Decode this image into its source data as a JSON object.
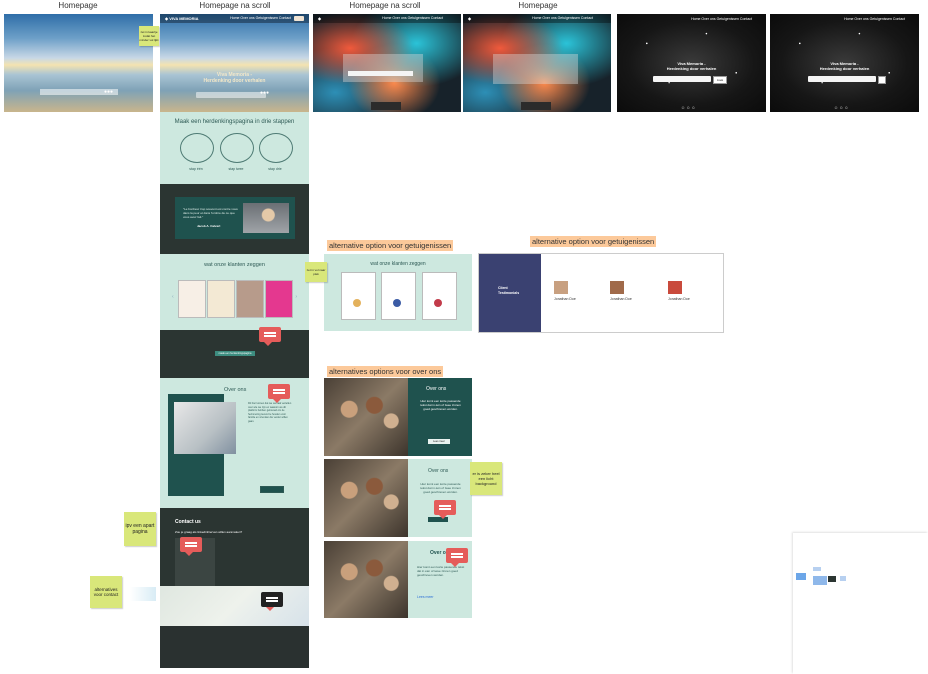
{
  "frames": {
    "titles": [
      "Homepage",
      "Homepage na scroll",
      "Homepage na scroll",
      "Homepage"
    ]
  },
  "hero": {
    "title_line1": "Viva Memoria -",
    "title_line2": "Herdenking door verhalen",
    "search_button": "zoek"
  },
  "steps_section": {
    "heading": "Maak een herdenkingspagina in drie stappen",
    "steps": [
      "stap één",
      "stap twee",
      "stap drie"
    ]
  },
  "quote_section": {
    "author": "Jacob A. Calvert"
  },
  "testimonials": {
    "heading": "wat onze klanten zeggen",
    "alt_heading": "wat onze klanten zeggen",
    "alt2_title": "Client Testimonials",
    "alt2_names": [
      "Jonathan Doe",
      "Jonathan Doe",
      "Jonathan Doe"
    ]
  },
  "cta": {
    "button": "maak een herdenkingspagina"
  },
  "about": {
    "heading": "Over ons",
    "alt_heading": "Over ons",
    "alt_text": "Hier komt een korte passende tekst dat in één of twee zinnen goed geschreven worden.",
    "alt_button": "Lees meer",
    "alt3_link": "Lees meer"
  },
  "contact": {
    "heading": "Contact us",
    "subheading": "Zou je graag als linkedinhiervan willen aanmaken?"
  },
  "labels": {
    "alt_testimonials_1": "alternative option voor getuigenissen",
    "alt_testimonials_2": "alternative option voor getuigenissen",
    "alt_about": "alternatives options voor over ons"
  },
  "stickies": {
    "s1": "zet in kaartje zodat het minder vol lijkt",
    "s2": "zet in vol naar plek",
    "s3": "ipv een apart pagina",
    "s4": "alternatives voor contact",
    "s5": "er is zeker heel een licht background"
  },
  "colors": {
    "mint": "#cde8df",
    "teal": "#1f524e",
    "dark": "#2b3532",
    "accent_orange": "#fcc99a",
    "sticky_yellow": "#d9e77a",
    "comment_red": "#e55c5a"
  }
}
